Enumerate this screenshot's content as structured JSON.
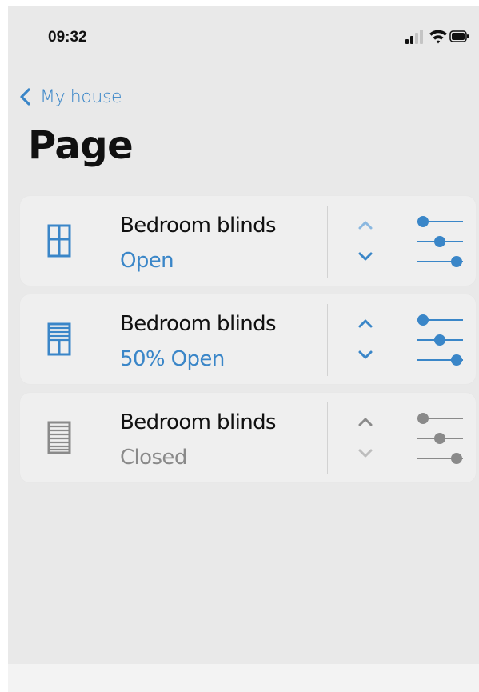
{
  "status_bar": {
    "time": "09:32"
  },
  "nav": {
    "back_label": "My house"
  },
  "page": {
    "title": "Page"
  },
  "colors": {
    "accent": "#3a86c8",
    "accent_light": "#8bb8e0",
    "muted": "#8a8a8a",
    "muted_light": "#bdbdbd"
  },
  "devices": [
    {
      "name": "Bedroom blinds",
      "status": "Open",
      "state": "open",
      "icon": "window-open-icon"
    },
    {
      "name": "Bedroom blinds",
      "status": "50% Open",
      "state": "half",
      "icon": "window-half-open-icon"
    },
    {
      "name": "Bedroom blinds",
      "status": "Closed",
      "state": "closed",
      "icon": "window-closed-icon"
    }
  ]
}
